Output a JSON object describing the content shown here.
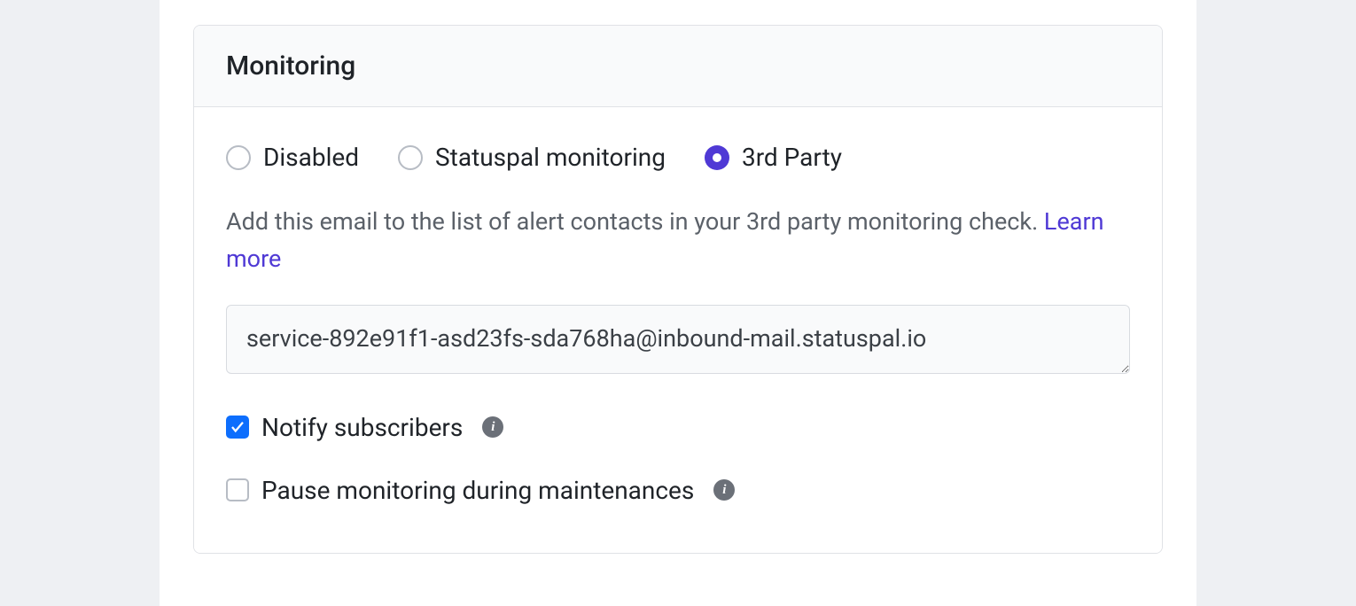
{
  "panel": {
    "title": "Monitoring",
    "radios": {
      "disabled": "Disabled",
      "statuspal": "Statuspal monitoring",
      "third_party": "3rd Party"
    },
    "description_pre": "Add this email to the list of alert contacts in your 3rd party monitoring check. ",
    "learn_more": "Learn more",
    "email": "service-892e91f1-asd23fs-sda768ha@inbound-mail.statuspal.io",
    "checks": {
      "notify": "Notify subscribers",
      "pause": "Pause monitoring during maintenances"
    }
  }
}
